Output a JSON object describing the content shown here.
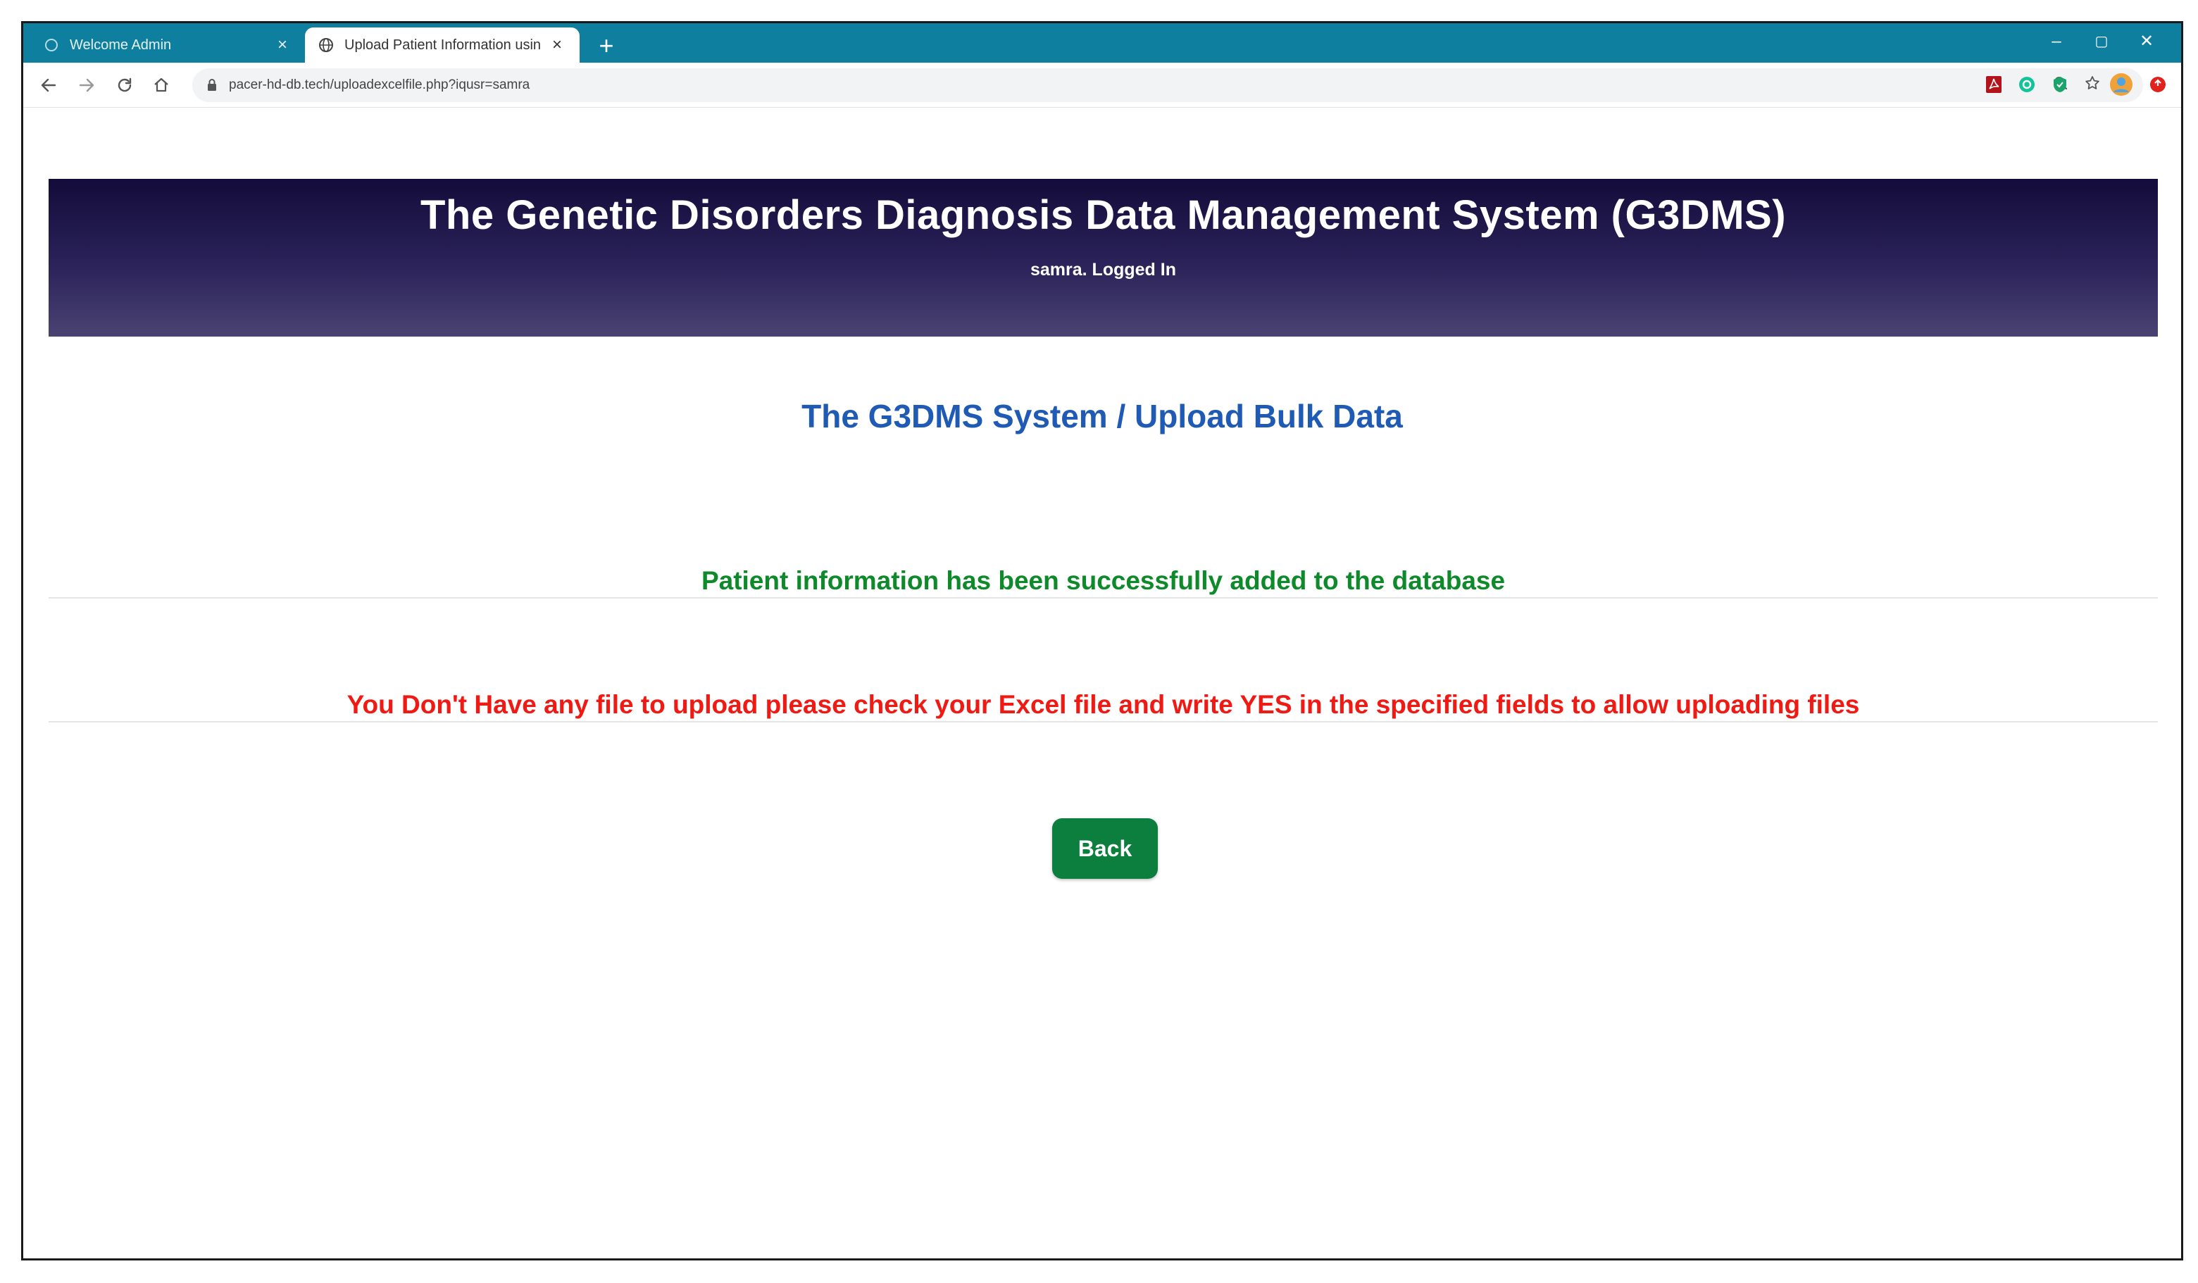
{
  "browser": {
    "tabs": [
      {
        "title": "Welcome Admin",
        "active": false
      },
      {
        "title": "Upload Patient Information usin",
        "active": true
      }
    ],
    "new_tab_label": "+",
    "window_controls": {
      "minimize": "–",
      "restore": "▢",
      "close": "✕"
    },
    "url": "pacer-hd-db.tech/uploadexcelfile.php?iqusr=samra"
  },
  "header": {
    "title": "The Genetic Disorders Diagnosis Data Management System (G3DMS)",
    "subtitle": "samra. Logged In"
  },
  "main": {
    "section_title": "The G3DMS System / Upload Bulk Data",
    "success_message": "Patient information has been successfully added to the database",
    "error_message": "You Don't Have any file to upload please check your Excel file and write YES in the specified fields to allow uploading files",
    "back_label": "Back"
  },
  "colors": {
    "tabstrip": "#0e7f9e",
    "banner_top": "#130c3a",
    "banner_bottom": "#4a4372",
    "section_title": "#1f5bb5",
    "success": "#0f8a2b",
    "error": "#f01a14",
    "back_button": "#0c7f3f"
  }
}
